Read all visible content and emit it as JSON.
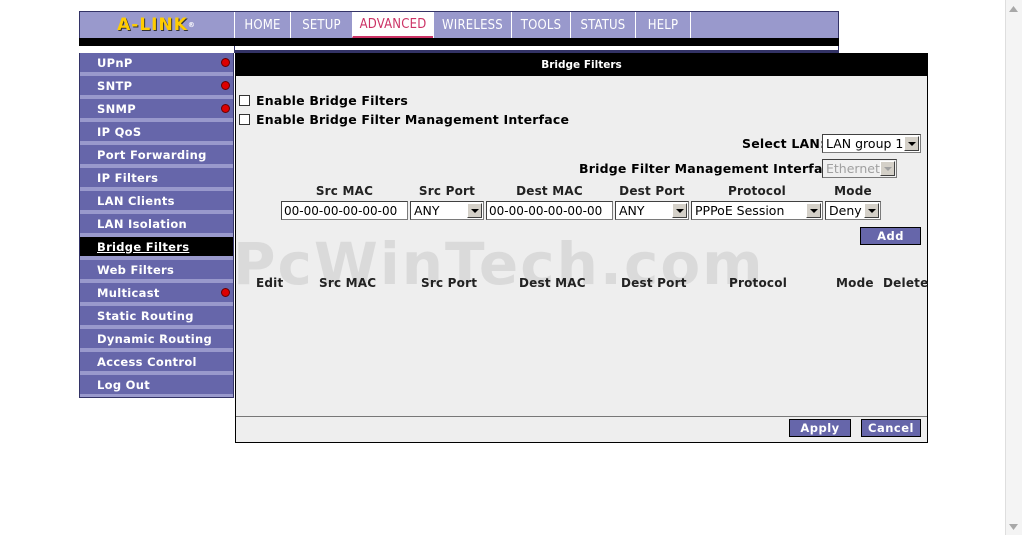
{
  "brand": {
    "name": "A-LINK",
    "mark": "®"
  },
  "nav": {
    "tabs": [
      {
        "label": "HOME"
      },
      {
        "label": "SETUP"
      },
      {
        "label": "ADVANCED"
      },
      {
        "label": "WIRELESS"
      },
      {
        "label": "TOOLS"
      },
      {
        "label": "STATUS"
      },
      {
        "label": "HELP"
      }
    ],
    "active": "ADVANCED"
  },
  "sidebar": {
    "items": [
      {
        "label": "UPnP",
        "dot": true
      },
      {
        "label": "SNTP",
        "dot": true
      },
      {
        "label": "SNMP",
        "dot": true
      },
      {
        "label": "IP QoS",
        "dot": false
      },
      {
        "label": "Port Forwarding",
        "dot": false
      },
      {
        "label": "IP Filters",
        "dot": false
      },
      {
        "label": "LAN Clients",
        "dot": false
      },
      {
        "label": "LAN Isolation",
        "dot": false
      },
      {
        "label": "Bridge Filters",
        "dot": false,
        "active": true
      },
      {
        "label": "Web Filters",
        "dot": false
      },
      {
        "label": "Multicast",
        "dot": true
      },
      {
        "label": "Static Routing",
        "dot": false
      },
      {
        "label": "Dynamic Routing",
        "dot": false
      },
      {
        "label": "Access Control",
        "dot": false
      },
      {
        "label": "Log Out",
        "dot": false
      }
    ]
  },
  "panel": {
    "title": "Bridge Filters",
    "enable_bridge_filters": "Enable Bridge Filters",
    "enable_mgmt_interface": "Enable Bridge Filter Management Interface",
    "select_lan_label": "Select LAN:",
    "select_lan_value": "LAN group 1",
    "mgmt_interface_label": "Bridge Filter Management Interface:",
    "mgmt_interface_value": "Ethernet",
    "columns": [
      "Src MAC",
      "Src Port",
      "Dest MAC",
      "Dest Port",
      "Protocol",
      "Mode"
    ],
    "src_mac": "00-00-00-00-00-00",
    "src_port": "ANY",
    "dest_mac": "00-00-00-00-00-00",
    "dest_port": "ANY",
    "protocol": "PPPoE Session",
    "mode": "Deny",
    "add_label": "Add",
    "list_columns": [
      "Edit",
      "Src MAC",
      "Src Port",
      "Dest MAC",
      "Dest Port",
      "Protocol",
      "Mode",
      "Delete"
    ],
    "apply_label": "Apply",
    "cancel_label": "Cancel"
  },
  "watermark": "PcWinTech.com",
  "colors": {
    "nav_bg": "#9999cc",
    "sidebar_item": "#6666aa",
    "active_tab_text": "#cc3366",
    "brand": "#ffcc00"
  }
}
